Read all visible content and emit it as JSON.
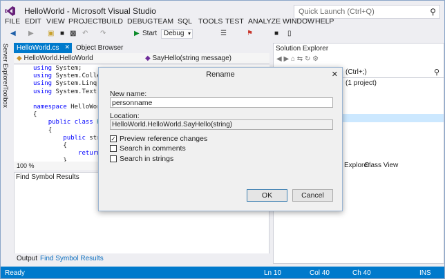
{
  "window": {
    "title": "HelloWorld - Microsoft Visual Studio",
    "quick_launch_placeholder": "Quick Launch (Ctrl+Q)"
  },
  "menu": [
    "FILE",
    "EDIT",
    "VIEW",
    "PROJECT",
    "BUILD",
    "DEBUG",
    "TEAM",
    "SQL",
    "TOOLS",
    "TEST",
    "ANALYZE",
    "WINDOW",
    "HELP"
  ],
  "toolbar": {
    "start_label": "Start",
    "config_value": "Debug"
  },
  "left_strip": {
    "server_explorer": "Server Explorer",
    "toolbox": "Toolbox"
  },
  "editor": {
    "tabs": [
      {
        "label": "HelloWorld.cs"
      },
      {
        "label": "Object Browser"
      }
    ],
    "nav_class": "HelloWorld.HelloWorld",
    "nav_member": "SayHello(string message)",
    "zoom": "100 %",
    "code_lines": [
      "using System;",
      "using System.Collect",
      "using System.Linq;",
      "using System.Text;",
      "",
      "namespace HelloWorld",
      "{",
      "    public class He",
      "    {",
      "        public strin",
      "        {",
      "            return",
      "        }"
    ]
  },
  "find_panel": {
    "title": "Find Symbol Results"
  },
  "bottom_tabs": [
    "Output",
    "Find Symbol Results"
  ],
  "solution_explorer": {
    "title": "Solution Explorer",
    "search_placeholder": "(Ctrl+;)",
    "project_text": "(1 project)",
    "tabs": [
      "Explorer",
      "Class View"
    ]
  },
  "status_bar": {
    "ready": "Ready",
    "line": "Ln 10",
    "col": "Col 40",
    "ch": "Ch 40",
    "mode": "INS"
  },
  "dialog": {
    "title": "Rename",
    "new_name_label": "New name:",
    "new_name_value": "personname",
    "location_label": "Location:",
    "location_value": "HelloWorld.HelloWorld.SayHello(string)",
    "options": [
      {
        "label": "Preview reference changes",
        "checked": true
      },
      {
        "label": "Search in comments",
        "checked": false
      },
      {
        "label": "Search in strings",
        "checked": false
      }
    ],
    "ok_label": "OK",
    "cancel_label": "Cancel"
  },
  "colors": {
    "accent": "#007acc",
    "background": "#eeeef2",
    "dialog_bg": "#f0f0f0",
    "selection": "#cce8ff"
  }
}
